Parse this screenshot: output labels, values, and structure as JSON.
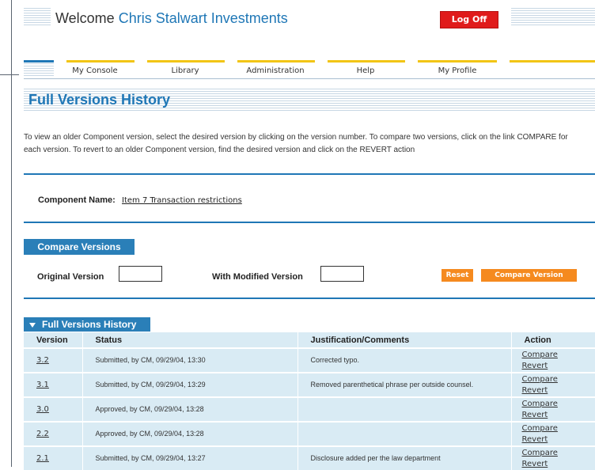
{
  "header": {
    "welcome_prefix": "Welcome",
    "company": "Chris Stalwart Investments",
    "logoff_label": "Log Off"
  },
  "nav": {
    "items": [
      {
        "label": "My Console"
      },
      {
        "label": "Library"
      },
      {
        "label": "Administration"
      },
      {
        "label": "Help"
      },
      {
        "label": "My Profile"
      }
    ]
  },
  "page": {
    "title": "Full Versions History",
    "instructions": "To view an older Component version, select the desired version by clicking on the version number. To compare two versions, click on the link COMPARE for each version. To revert to an older Component version, find the desired version and click on the REVERT action"
  },
  "component": {
    "label": "Component Name:",
    "name": "Item 7 Transaction restrictions"
  },
  "compare": {
    "section_title": "Compare Versions",
    "original_label": "Original Version",
    "original_value": "",
    "modified_label": "With Modified Version",
    "modified_value": "",
    "reset_label": "Reset",
    "compare_label": "Compare Version"
  },
  "history": {
    "section_title": "Full Versions History",
    "columns": [
      "Version",
      "Status",
      "Justification/Comments",
      "Action"
    ],
    "rows": [
      {
        "version": "3.2",
        "status": "Submitted, by CM, 09/29/04, 13:30",
        "comment": "Corrected typo.",
        "compare": "Compare",
        "revert": "Revert"
      },
      {
        "version": "3.1",
        "status": "Submitted, by CM, 09/29/04, 13:29",
        "comment": "Removed parenthetical phrase per outside counsel.",
        "compare": "Compare",
        "revert": "Revert"
      },
      {
        "version": "3.0",
        "status": "Approved, by CM, 09/29/04, 13:28",
        "comment": "",
        "compare": "Compare",
        "revert": "Revert"
      },
      {
        "version": "2.2",
        "status": "Approved, by CM, 09/29/04, 13:28",
        "comment": "",
        "compare": "Compare",
        "revert": "Revert"
      },
      {
        "version": "2.1",
        "status": "Submitted, by CM, 09/29/04, 13:27",
        "comment": "Disclosure added per the law department",
        "compare": "Compare",
        "revert": "Revert"
      }
    ]
  },
  "colors": {
    "brand_blue": "#1f77b6",
    "nav_yellow": "#f2c515",
    "logoff_red": "#e01b1b",
    "button_orange": "#f58a1f",
    "table_bg": "#d9ebf4"
  }
}
